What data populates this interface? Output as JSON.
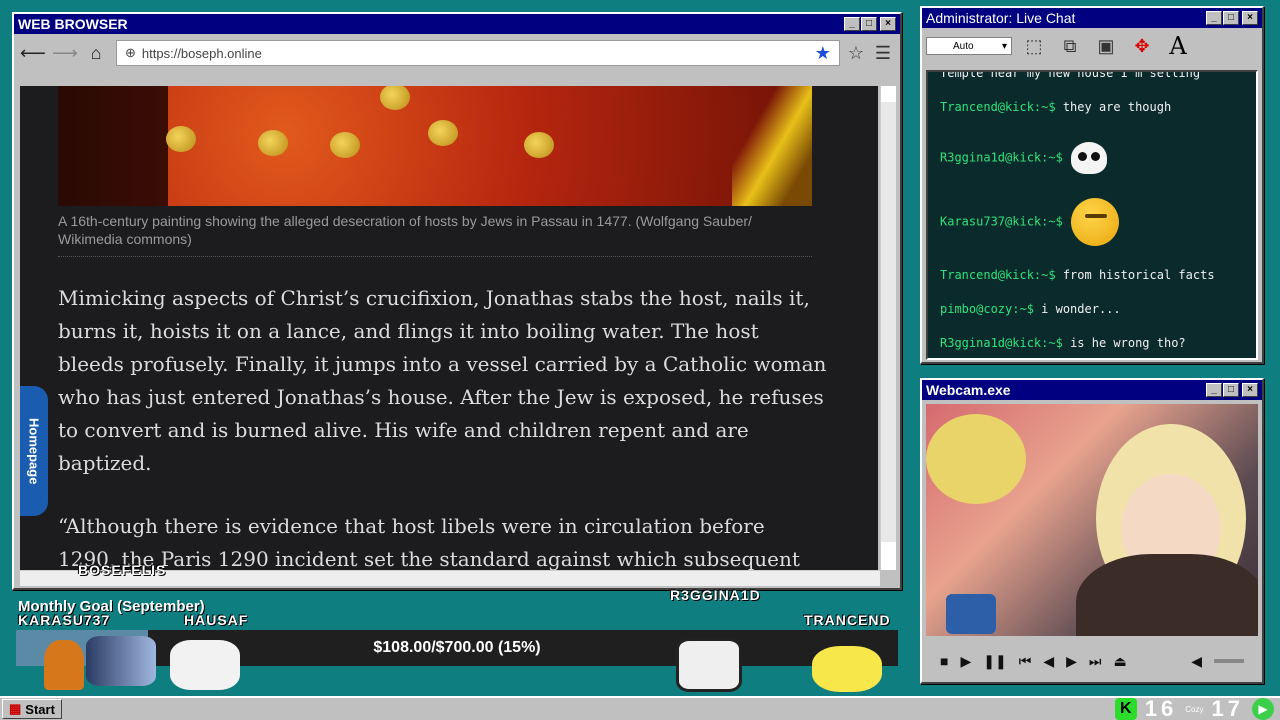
{
  "browser": {
    "title": "WEB BROWSER",
    "url": "https://boseph.online",
    "caption": "A 16th-century painting showing the alleged desecration of hosts by Jews in Passau in 1477. (Wolfgang Sauber/ Wikimedia commons)",
    "paragraph": "Mimicking aspects of Christ’s crucifixion, Jonathas stabs the host, nails it, burns it, hoists it on a lance, and flings it into boiling water. The host bleeds profusely. Finally, it jumps into a vessel carried by a Catholic woman who has just entered Jonathas’s house. After the Jew is exposed, he refuses to convert and is burned alive. His wife and children repent and are baptized.",
    "quote": "“Although there is evidence that host libels were in circulation before 1290, the Paris 1290 incident set the standard against which subsequent",
    "side_tab": "Homepage"
  },
  "chat": {
    "title": "Administrator: Live Chat",
    "select_value": "Auto",
    "messages": [
      {
        "user": "",
        "text": "Temple near my new house I'm selling"
      },
      {
        "user": "Trancend@kick:~$",
        "text": "they are though"
      },
      {
        "user": "R3ggina1d@kick:~$",
        "text": "",
        "emote": "skull-emote"
      },
      {
        "user": "Karasu737@kick:~$",
        "text": "",
        "emote": "thinking-emote"
      },
      {
        "user": "Trancend@kick:~$",
        "text": "from historical facts"
      },
      {
        "user": "pimbo@cozy:~$",
        "text": "i wonder..."
      },
      {
        "user": "R3ggina1d@kick:~$",
        "text": "is he wrong tho?"
      }
    ]
  },
  "webcam": {
    "title": "Webcam.exe"
  },
  "goal": {
    "label": "Monthly Goal (September)",
    "text": "$108.00/$700.00 (15%)",
    "percent": 15,
    "donors": [
      "BOSEFELIS",
      "KARASU737",
      "HAUSAF",
      "R3GGINA1D",
      "TRANCEND"
    ]
  },
  "taskbar": {
    "start": "Start",
    "count_a": "16",
    "count_b": "17",
    "cozy_label": "Cozy"
  }
}
